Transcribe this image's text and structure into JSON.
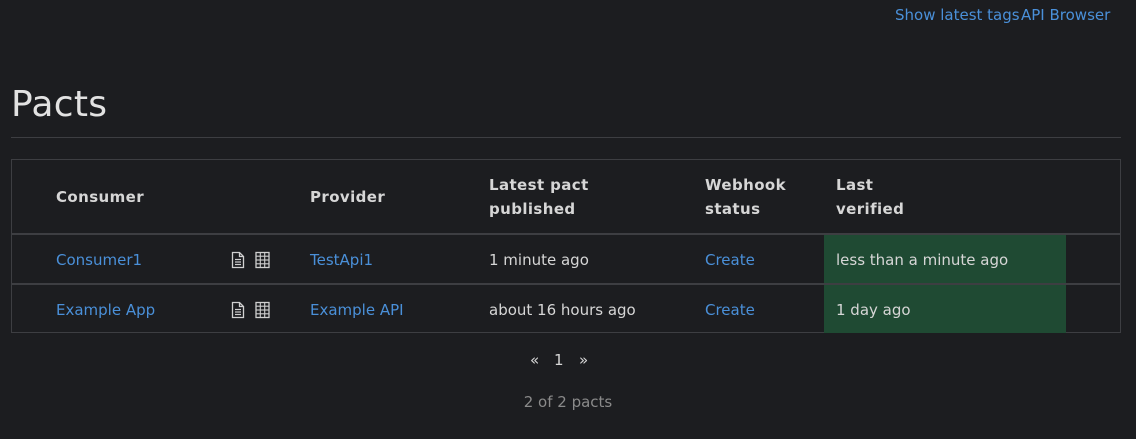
{
  "top_links": {
    "latest_tags": "Show latest tags",
    "api_browser": "API Browser"
  },
  "page_title": "Pacts",
  "table": {
    "headers": {
      "consumer": "Consumer",
      "provider": "Provider",
      "latest_pact_line1": "Latest pact",
      "latest_pact_line2": "published",
      "webhook_line1": "Webhook",
      "webhook_line2": "status",
      "verified_line1": "Last",
      "verified_line2": "verified"
    },
    "rows": [
      {
        "consumer": "Consumer1",
        "provider": "TestApi1",
        "latest_pact": "1 minute ago",
        "webhook": "Create",
        "last_verified": "less than a minute ago",
        "icons": [
          "document-icon",
          "matrix-icon"
        ]
      },
      {
        "consumer": "Example App",
        "provider": "Example API",
        "latest_pact": "about 16 hours ago",
        "webhook": "Create",
        "last_verified": "1 day ago",
        "icons": [
          "document-icon",
          "matrix-icon"
        ]
      }
    ]
  },
  "pagination": {
    "prev": "«",
    "current": "1",
    "next": "»"
  },
  "count_text": "2 of 2 pacts",
  "colors": {
    "background": "#1c1d20",
    "link": "#4a90d9",
    "verified_success": "#1f4a33",
    "border": "#3d3e42"
  }
}
